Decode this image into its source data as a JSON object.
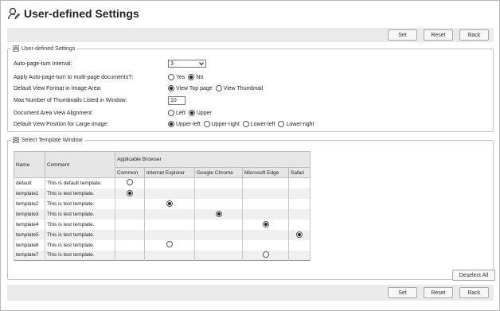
{
  "page": {
    "title": "User-defined Settings"
  },
  "toolbar": {
    "set_label": "Set",
    "reset_label": "Reset",
    "back_label": "Back"
  },
  "settings": {
    "legend": "User-defined Settings",
    "auto_turn_interval": {
      "label": "Auto-page-turn Interval:",
      "value": "3"
    },
    "apply_auto_turn": {
      "label": "Apply Auto-page-turn to multi-page documents?:",
      "options": [
        "Yes",
        "No"
      ],
      "selected": "No"
    },
    "default_view_format": {
      "label": "Default View Format in Image Area:",
      "options": [
        "View Top page",
        "View Thumbnail"
      ],
      "selected": "View Top page"
    },
    "max_thumbnails": {
      "label": "Max Number of Thumbnails Listed in Window:",
      "value": "10"
    },
    "doc_view_alignment": {
      "label": "Document Area View Alignment:",
      "options": [
        "Left",
        "Upper"
      ],
      "selected": "Upper"
    },
    "default_view_position": {
      "label": "Default View Position for Large Image:",
      "options": [
        "Upper-left",
        "Upper-right",
        "Lower-left",
        "Lower-right"
      ],
      "selected": "Upper-left"
    }
  },
  "template_window": {
    "legend": "Select Template Window",
    "columns": {
      "name": "Name",
      "comment": "Comment",
      "applicable": "Applicable Browser"
    },
    "browsers": [
      "Common",
      "Internet Explorer",
      "Google Chrome",
      "Microsoft Edge",
      "Safari"
    ],
    "rows": [
      {
        "name": "default",
        "comment": "This is default template.",
        "selected_index": 0,
        "checked": false
      },
      {
        "name": "template1",
        "comment": "This is test template.",
        "selected_index": 0,
        "checked": true
      },
      {
        "name": "template2",
        "comment": "This is test template.",
        "selected_index": 1,
        "checked": true
      },
      {
        "name": "template3",
        "comment": "This is test template.",
        "selected_index": 2,
        "checked": true
      },
      {
        "name": "template4",
        "comment": "This is test template.",
        "selected_index": 3,
        "checked": true
      },
      {
        "name": "template5",
        "comment": "This is test template.",
        "selected_index": 4,
        "checked": true
      },
      {
        "name": "template6",
        "comment": "This is test template.",
        "selected_index": 1,
        "checked": false
      },
      {
        "name": "template7",
        "comment": "This is test template.",
        "selected_index": 3,
        "checked": false
      }
    ],
    "deselect_label": "Deselect All"
  }
}
